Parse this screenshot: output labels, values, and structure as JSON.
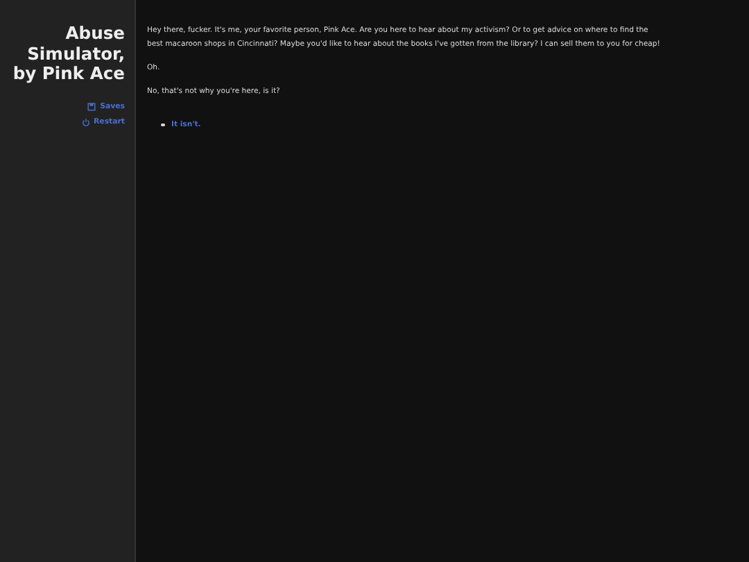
{
  "sidebar": {
    "title": "Abuse Simulator, by Pink Ace",
    "menu": [
      {
        "kind": "saves",
        "label": "Saves"
      },
      {
        "kind": "restart",
        "label": "Restart"
      }
    ]
  },
  "passage": {
    "paragraphs": [
      "Hey there, fucker. It's me, your favorite person, Pink Ace. Are you here to hear about my activism? Or to get advice on where to find the best macaroon shops in Cincinnati? Maybe you'd like to hear about the books I've gotten from the library? I can sell them to you for cheap!",
      "Oh.",
      "No, that's not why you're here, is it?"
    ],
    "choices": [
      {
        "label": "It isn't."
      }
    ]
  }
}
